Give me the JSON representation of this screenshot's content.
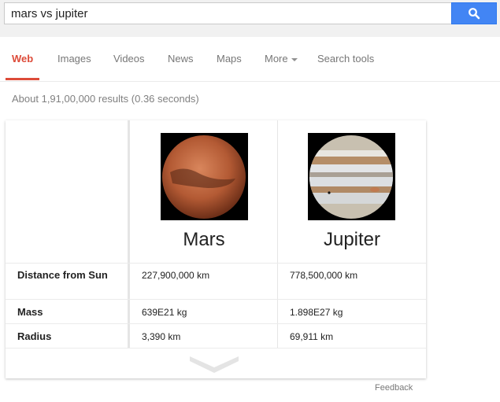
{
  "search": {
    "query": "mars vs jupiter",
    "button_icon": "search-icon"
  },
  "tabs": [
    {
      "label": "Web",
      "active": true
    },
    {
      "label": "Images"
    },
    {
      "label": "Videos"
    },
    {
      "label": "News"
    },
    {
      "label": "Maps"
    },
    {
      "label": "More"
    },
    {
      "label": "Search tools"
    }
  ],
  "results_stats": "About 1,91,00,000 results (0.36 seconds)",
  "comparison": {
    "planets": [
      {
        "name": "Mars",
        "image": "mars-image"
      },
      {
        "name": "Jupiter",
        "image": "jupiter-image"
      }
    ],
    "rows": [
      {
        "label": "Distance from Sun",
        "values": [
          "227,900,000 km",
          "778,500,000 km"
        ]
      },
      {
        "label": "Mass",
        "values": [
          "639E21 kg",
          "1.898E27 kg"
        ]
      },
      {
        "label": "Radius",
        "values": [
          "3,390 km",
          "69,911 km"
        ]
      }
    ],
    "expand_icon": "chevron-down-icon"
  },
  "feedback_label": "Feedback",
  "colors": {
    "accent": "#dd4b39",
    "search_button": "#4285f4"
  }
}
